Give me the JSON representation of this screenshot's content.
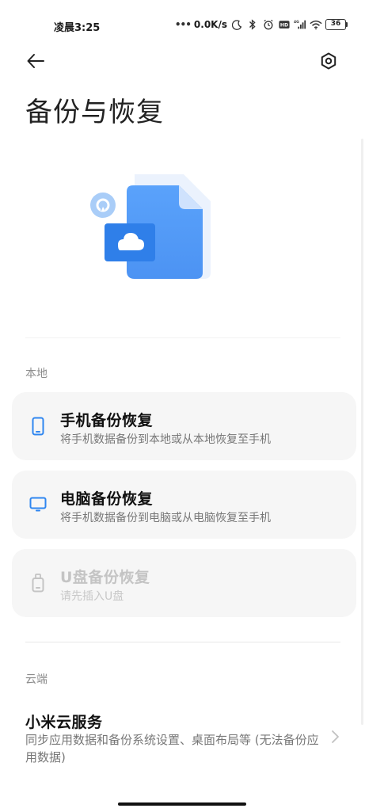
{
  "status_bar": {
    "time": "凌晨3:25",
    "dots": "•••",
    "net_speed": "0.0K/s",
    "battery": "36",
    "icons": [
      "moon-icon",
      "bluetooth-icon",
      "alarm-icon",
      "hd-icon",
      "4g-signal-icon",
      "wifi-icon",
      "battery-icon"
    ]
  },
  "header": {
    "title": "备份与恢复",
    "back_icon": "back-arrow-icon",
    "settings_icon": "settings-icon"
  },
  "local": {
    "label": "本地",
    "items": [
      {
        "title": "手机备份恢复",
        "subtitle": "将手机数据备份到本地或从本地恢复至手机",
        "icon": "phone-icon",
        "enabled": true
      },
      {
        "title": "电脑备份恢复",
        "subtitle": "将手机数据备份到电脑或从电脑恢复至手机",
        "icon": "computer-icon",
        "enabled": true
      },
      {
        "title": "U盘备份恢复",
        "subtitle": "请先插入U盘",
        "icon": "usb-drive-icon",
        "enabled": false
      }
    ]
  },
  "cloud": {
    "label": "云端",
    "title": "小米云服务",
    "subtitle": "同步应用数据和备份系统设置、桌面布局等 (无法备份应用数据)"
  },
  "colors": {
    "accent": "#3b8ff5",
    "card_bg": "#f6f6f6",
    "disabled": "#c4c4c4"
  }
}
